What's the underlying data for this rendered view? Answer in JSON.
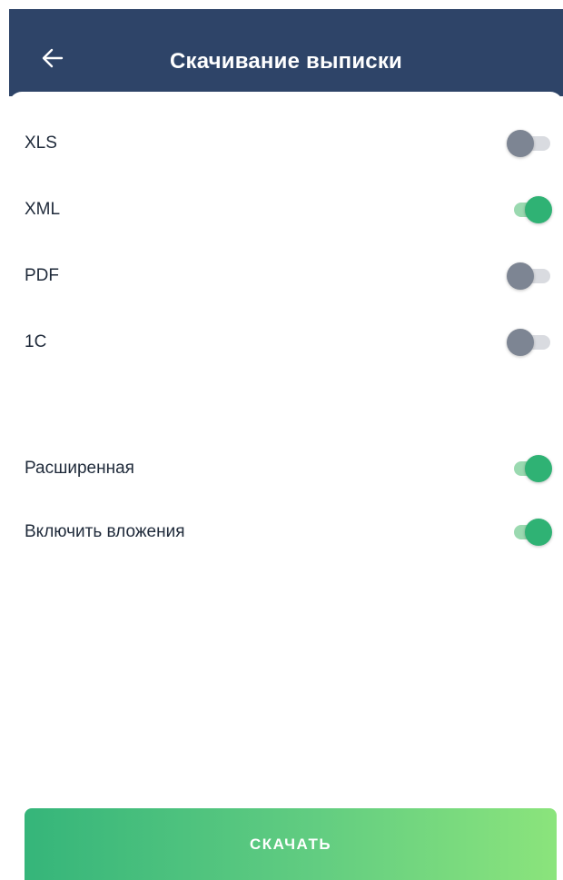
{
  "header": {
    "title": "Скачивание выписки",
    "back_icon": "arrow-left-icon"
  },
  "formats": [
    {
      "label": "XLS",
      "enabled": false
    },
    {
      "label": "XML",
      "enabled": true
    },
    {
      "label": "PDF",
      "enabled": false
    },
    {
      "label": "1C",
      "enabled": false
    }
  ],
  "options": [
    {
      "label": "Расширенная",
      "enabled": true
    },
    {
      "label": "Включить вложения",
      "enabled": true
    }
  ],
  "download_button": {
    "label": "СКАЧАТЬ"
  },
  "colors": {
    "header_bg": "#2e4468",
    "toggle_on_knob": "#2fb274",
    "toggle_on_track": "#9ad9b0",
    "toggle_off_knob": "#7d8593",
    "toggle_off_track": "#d9dbe0",
    "button_gradient_start": "#35b57a",
    "button_gradient_end": "#8be47c"
  }
}
